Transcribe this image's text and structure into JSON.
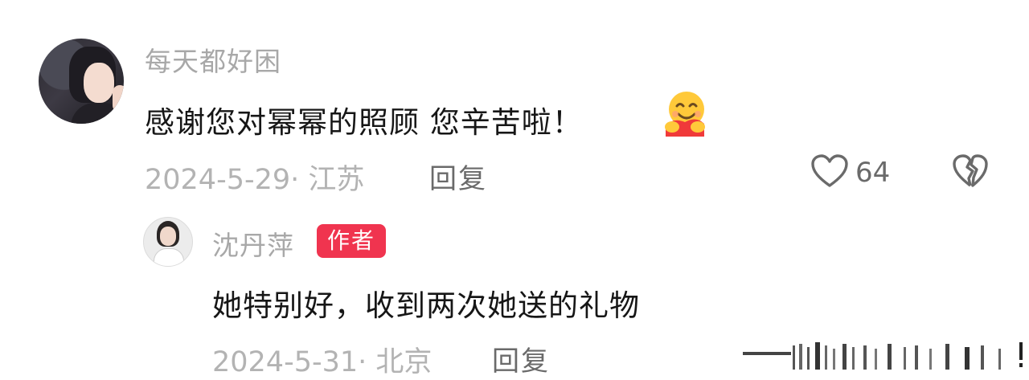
{
  "comment": {
    "username": "每天都好困",
    "text": "感谢您对幂幂的照顾 您辛苦啦！",
    "emoji": "hug-emoji",
    "date_location": "2024-5-29· 江苏",
    "reply_label": "回复",
    "like_count": "64"
  },
  "reply": {
    "username": "沈丹萍",
    "badge": "作者",
    "text": "她特别好，收到两次她送的礼物",
    "date_location": "2024-5-31· 北京",
    "reply_label": "回复"
  },
  "colors": {
    "badge": "#f0344f",
    "username": "#a8a8a8",
    "meta": "#b3b3b3"
  }
}
